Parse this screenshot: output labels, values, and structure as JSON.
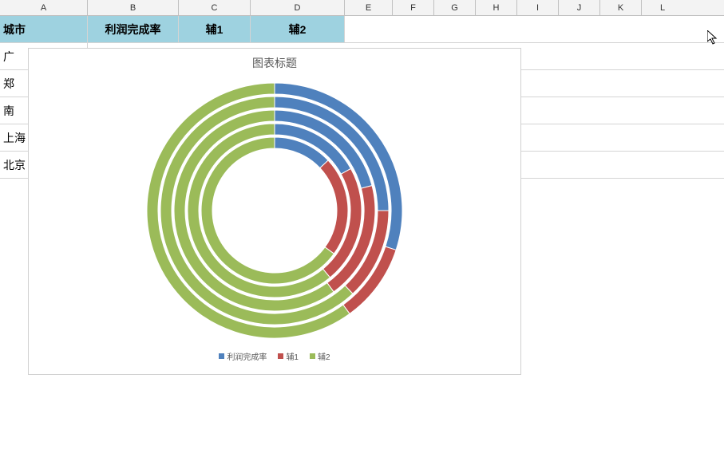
{
  "columns": [
    "A",
    "B",
    "C",
    "D",
    "E",
    "F",
    "G",
    "H",
    "I",
    "J",
    "K",
    "L"
  ],
  "table": {
    "headers": [
      "城市",
      "利润完成率",
      "辅1",
      "辅2"
    ],
    "rows": [
      "广",
      "郑",
      "南",
      "上海",
      "北京"
    ]
  },
  "chart": {
    "title": "图表标题",
    "legend": [
      {
        "label": "利润完成率",
        "color": "#4f81bd"
      },
      {
        "label": "辅1",
        "color": "#c0504d"
      },
      {
        "label": "辅2",
        "color": "#9bbb59"
      }
    ]
  },
  "chart_data": {
    "type": "pie",
    "subtype": "multi-ring-doughnut",
    "title": "图表标题",
    "series_names": [
      "利润完成率",
      "辅1",
      "辅2"
    ],
    "colors": {
      "利润完成率": "#4f81bd",
      "辅1": "#c0504d",
      "辅2": "#9bbb59"
    },
    "categories": [
      "广",
      "郑",
      "南",
      "上海",
      "北京"
    ],
    "rings": [
      {
        "category": "广",
        "values": {
          "利润完成率": 0.3,
          "辅1": 0.1,
          "辅2": 0.6
        }
      },
      {
        "category": "郑",
        "values": {
          "利润完成率": 0.25,
          "辅1": 0.13,
          "辅2": 0.62
        }
      },
      {
        "category": "南",
        "values": {
          "利润完成率": 0.21,
          "辅1": 0.19,
          "辅2": 0.6
        }
      },
      {
        "category": "上海",
        "values": {
          "利润完成率": 0.17,
          "辅1": 0.22,
          "辅2": 0.61
        }
      },
      {
        "category": "北京",
        "values": {
          "利润完成率": 0.13,
          "辅1": 0.22,
          "辅2": 0.65
        }
      }
    ],
    "note": "values are fractions of each ring (sum ≈ 1). Outer ring = first category."
  }
}
